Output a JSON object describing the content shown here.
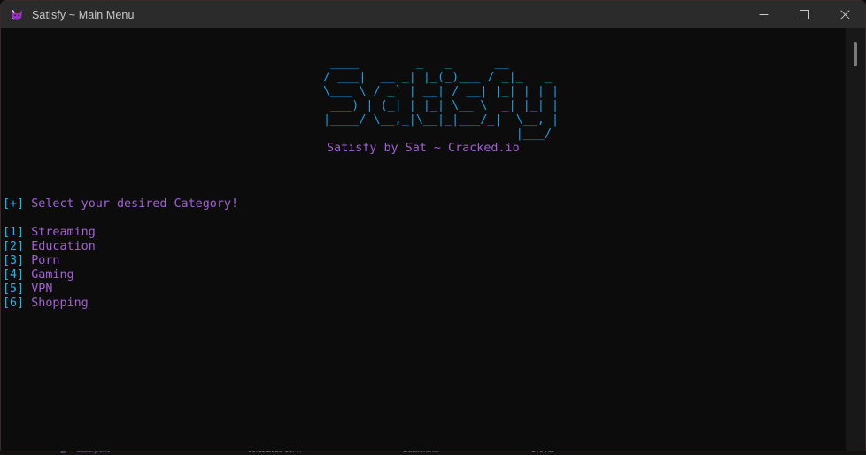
{
  "window": {
    "title": "Satisfy ~ Main Menu",
    "icon": "cat-logo-icon",
    "controls": {
      "minimize": "minimize-icon",
      "maximize": "maximize-icon",
      "close": "close-icon"
    }
  },
  "colors": {
    "titlebar_bg": "#2b2b2b",
    "console_bg": "#0c0c0c",
    "accent_cyan": "#19b9e8",
    "accent_purple": "#a25fd6",
    "banner_blue": "#18a0e0",
    "title_text": "#c8c8c8",
    "scrollbar_thumb": "#7a7a7a"
  },
  "console": {
    "banner": [
      "  ____        _   _      __       ",
      " / ___|  __ _| |_(_)___ / _|_   _ ",
      " \\___ \\ / _` | __| / __| |_| | | |",
      "  ___) | (_| | |_| \\__ \\  _| |_| |",
      " |____/ \\__,_|\\__|_|___/_|  \\__, |",
      "                            |___/ "
    ],
    "subtitle": "Satisfy by Sat ~ Cracked.io",
    "prompt": {
      "marker": "[+]",
      "text": "Select your desired Category!"
    },
    "menu": [
      {
        "key": "[1]",
        "label": "Streaming"
      },
      {
        "key": "[2]",
        "label": "Education"
      },
      {
        "key": "[3]",
        "label": "Porn"
      },
      {
        "key": "[4]",
        "label": "Gaming"
      },
      {
        "key": "[5]",
        "label": "VPN"
      },
      {
        "key": "[6]",
        "label": "Shopping"
      }
    ]
  },
  "scrollbar": {
    "thumb_position_percent": 3
  },
  "background_window": {
    "visible": "partially-occluded window behind, text not legible"
  }
}
